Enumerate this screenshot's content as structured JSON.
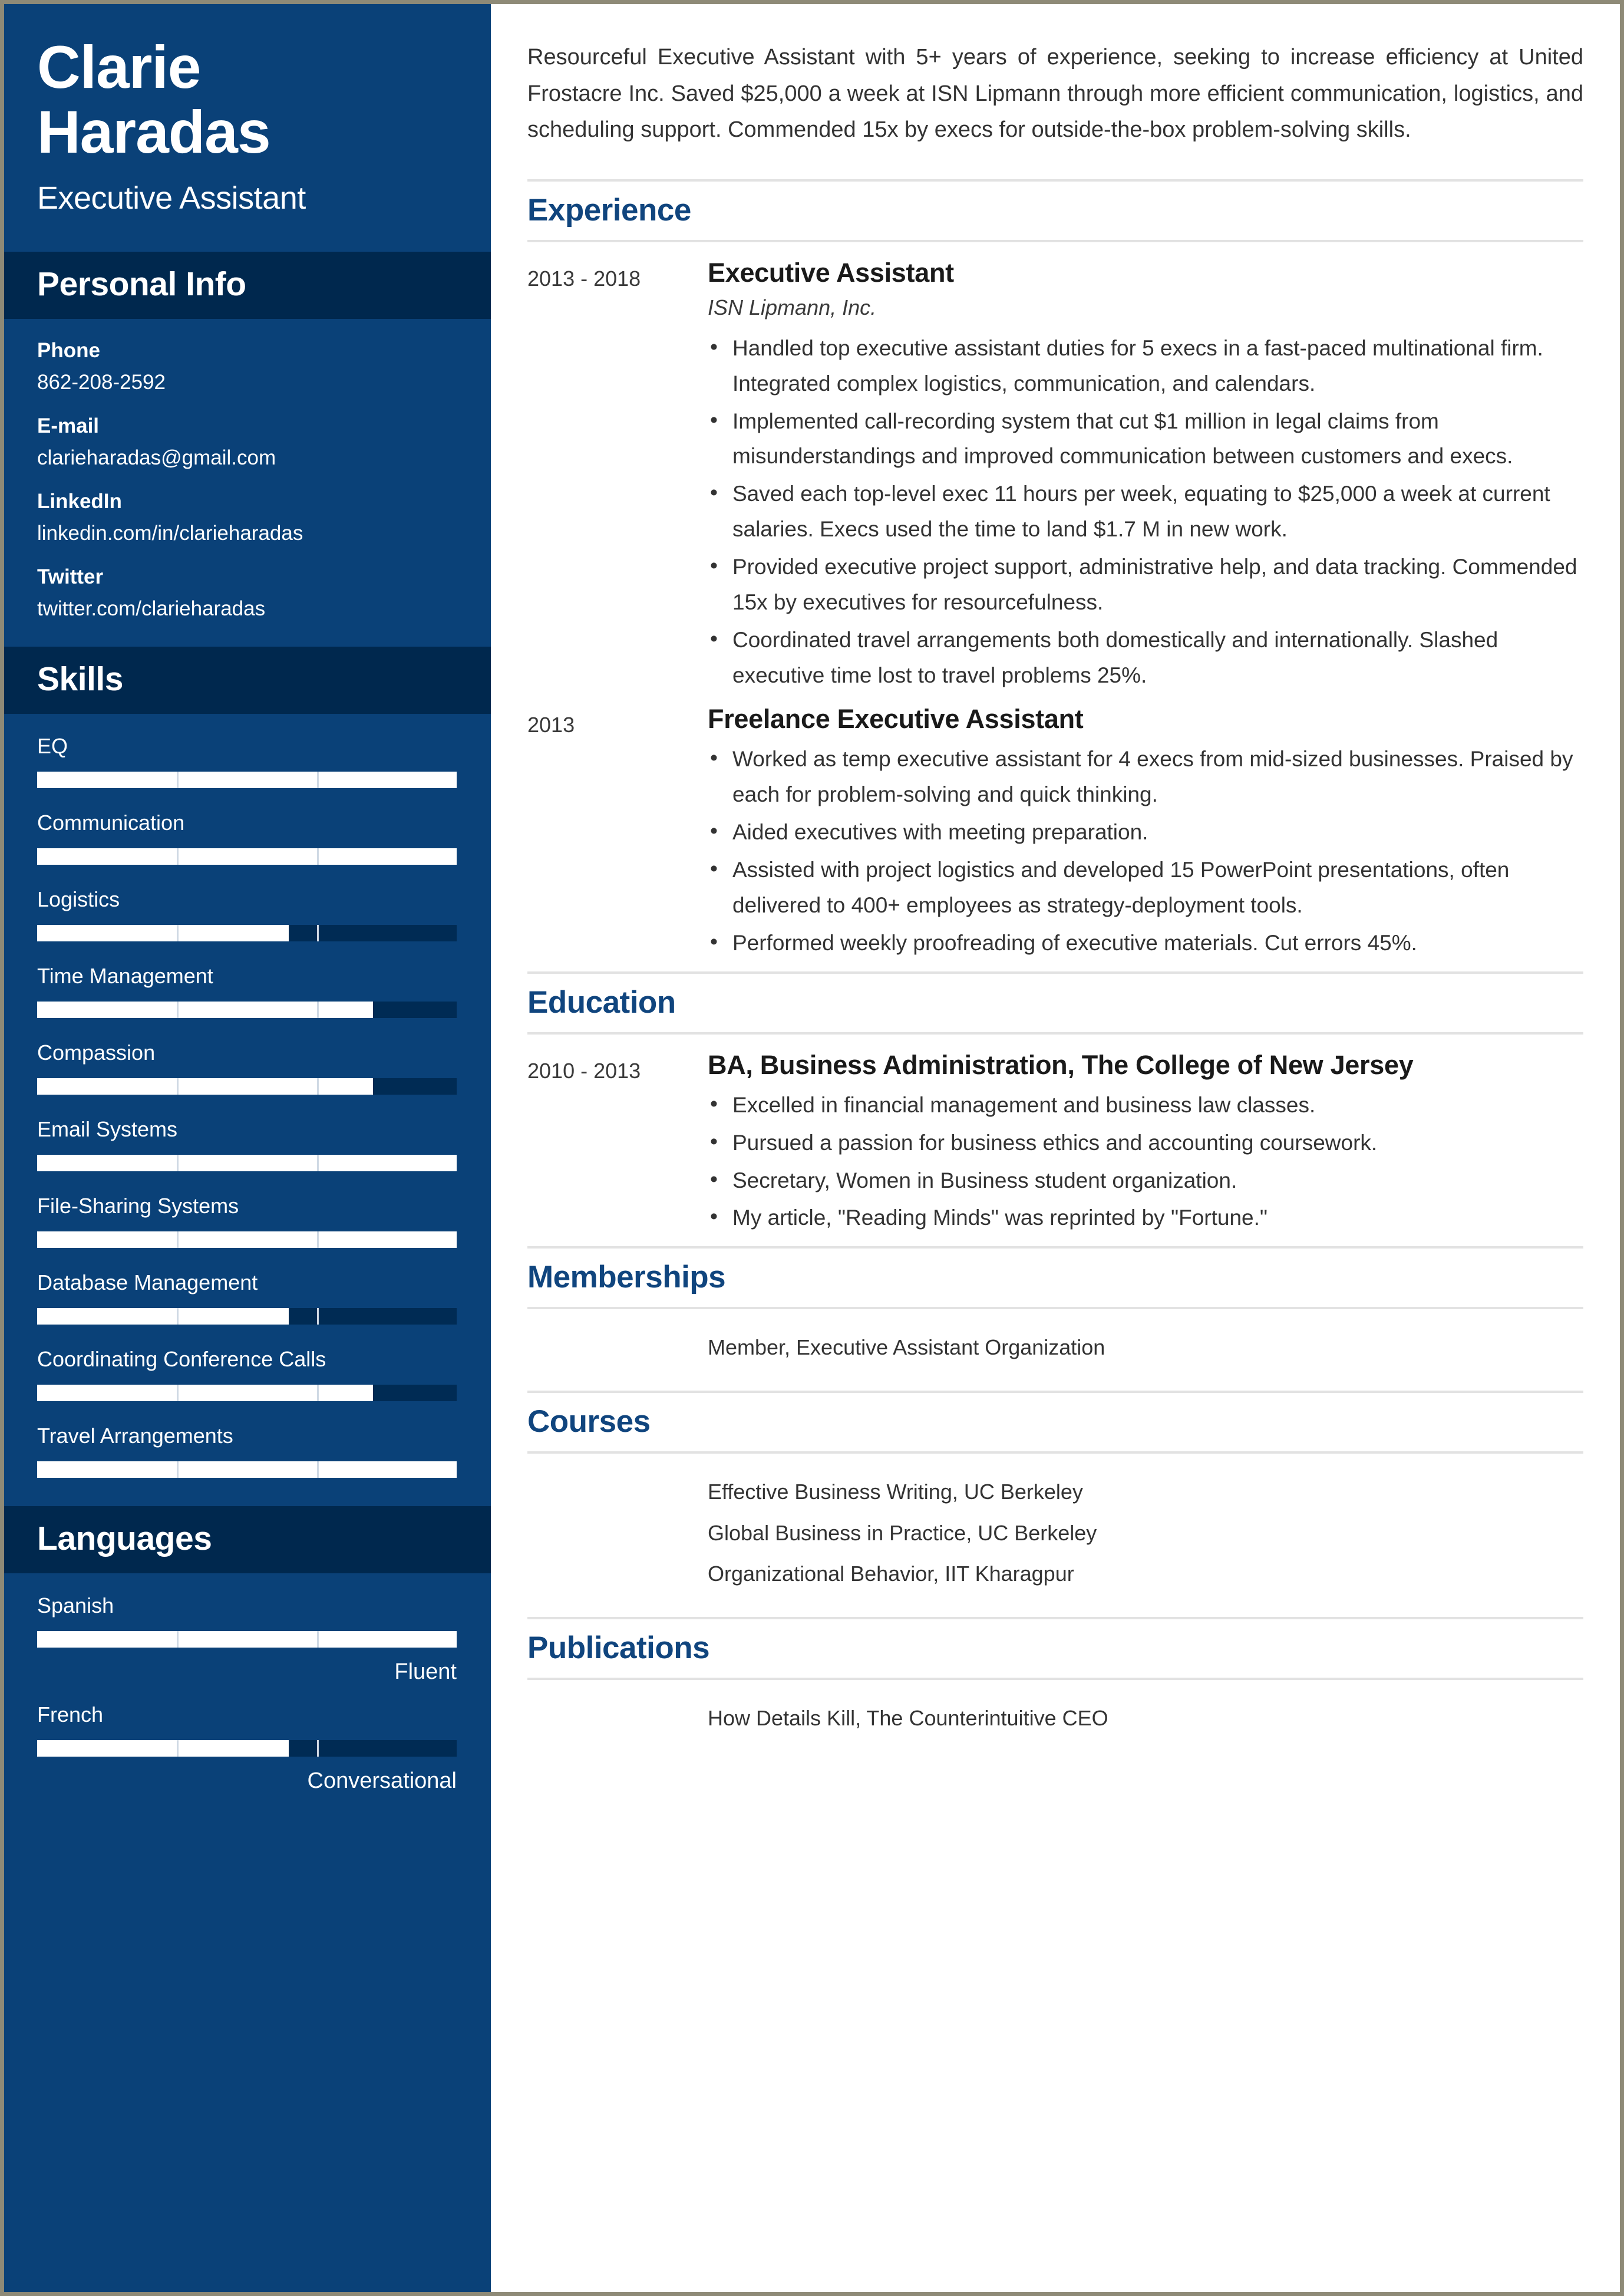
{
  "theme": {
    "sidebar_bg": "#0a4178",
    "sidebar_header_bg": "#00284e",
    "accent": "#10457e",
    "bar_fill": "#ffffff",
    "bar_track": "#002b54"
  },
  "sidebar": {
    "name": "Clarie Haradas",
    "name_line1": "Clarie",
    "name_line2": "Haradas",
    "job_title": "Executive Assistant",
    "personal_info": {
      "header": "Personal Info",
      "items": [
        {
          "label": "Phone",
          "value": "862-208-2592"
        },
        {
          "label": "E-mail",
          "value": "clarieharadas@gmail.com"
        },
        {
          "label": "LinkedIn",
          "value": "linkedin.com/in/clarieharadas"
        },
        {
          "label": "Twitter",
          "value": "twitter.com/clarieharadas"
        }
      ]
    },
    "skills": {
      "header": "Skills",
      "items": [
        {
          "name": "EQ",
          "level": 100
        },
        {
          "name": "Communication",
          "level": 100
        },
        {
          "name": "Logistics",
          "level": 60
        },
        {
          "name": "Time Management",
          "level": 80
        },
        {
          "name": "Compassion",
          "level": 80
        },
        {
          "name": "Email Systems",
          "level": 100
        },
        {
          "name": "File-Sharing Systems",
          "level": 100
        },
        {
          "name": "Database Management",
          "level": 60
        },
        {
          "name": "Coordinating Conference Calls",
          "level": 80
        },
        {
          "name": "Travel Arrangements",
          "level": 100
        }
      ]
    },
    "languages": {
      "header": "Languages",
      "items": [
        {
          "name": "Spanish",
          "level": 100,
          "proficiency": "Fluent"
        },
        {
          "name": "French",
          "level": 60,
          "proficiency": "Conversational"
        }
      ]
    }
  },
  "main": {
    "summary": "Resourceful Executive Assistant with 5+ years of experience, seeking to increase efficiency at United Frostacre Inc. Saved $25,000 a week at ISN Lipmann through more efficient communication, logistics, and scheduling support. Commended 15x by execs for outside-the-box problem-solving skills.",
    "experience": {
      "title": "Experience",
      "entries": [
        {
          "date": "2013 - 2018",
          "role": "Executive Assistant",
          "company": "ISN Lipmann, Inc.",
          "bullets": [
            "Handled top executive assistant duties for 5 execs in a fast-paced multinational firm. Integrated complex logistics, communication, and calendars.",
            "Implemented call-recording system that cut $1 million in legal claims from misunderstandings and improved communication between customers and execs.",
            "Saved each top-level exec 11 hours per week, equating to $25,000 a week at current salaries. Execs used the time to land $1.7 M in new work.",
            "Provided executive project support, administrative help, and data tracking. Commended 15x by executives for resourcefulness.",
            "Coordinated travel arrangements both domestically and internationally. Slashed executive time lost to travel problems 25%."
          ]
        },
        {
          "date": "2013",
          "role": "Freelance Executive Assistant",
          "company": "",
          "bullets": [
            "Worked as temp executive assistant for 4 execs from mid-sized businesses. Praised by each for problem-solving and quick thinking.",
            "Aided executives with meeting preparation.",
            "Assisted with project logistics and developed 15 PowerPoint presentations, often delivered to 400+ employees as strategy-deployment tools.",
            "Performed weekly proofreading of executive materials. Cut errors 45%."
          ]
        }
      ]
    },
    "education": {
      "title": "Education",
      "entries": [
        {
          "date": "2010 - 2013",
          "role": "BA, Business Administration, The College of New Jersey",
          "company": "",
          "bullets": [
            "Excelled in financial management and business law classes.",
            "Pursued a passion for business ethics and accounting coursework.",
            "Secretary, Women in Business student organization.",
            "My article, \"Reading Minds\" was reprinted by \"Fortune.\""
          ]
        }
      ]
    },
    "memberships": {
      "title": "Memberships",
      "items": [
        "Member, Executive Assistant Organization"
      ]
    },
    "courses": {
      "title": "Courses",
      "items": [
        "Effective Business Writing, UC Berkeley",
        "Global Business in Practice, UC Berkeley",
        "Organizational Behavior, IIT Kharagpur"
      ]
    },
    "publications": {
      "title": "Publications",
      "items": [
        "How Details Kill, The Counterintuitive CEO"
      ]
    }
  }
}
